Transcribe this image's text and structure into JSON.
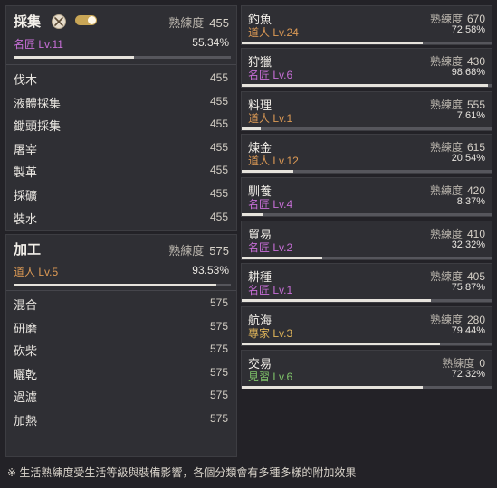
{
  "gathering": {
    "title": "採集",
    "prof_label": "熟練度",
    "prof_value": "455",
    "rank": "名匠 Lv.11",
    "rank_color": "#c86fd8",
    "percent_text": "55.34%",
    "percent": 55.34,
    "items": [
      {
        "name": "伐木",
        "value": "455"
      },
      {
        "name": "液體採集",
        "value": "455"
      },
      {
        "name": "鋤頭採集",
        "value": "455"
      },
      {
        "name": "屠宰",
        "value": "455"
      },
      {
        "name": "製革",
        "value": "455"
      },
      {
        "name": "採礦",
        "value": "455"
      },
      {
        "name": "裝水",
        "value": "455"
      }
    ]
  },
  "processing": {
    "title": "加工",
    "prof_label": "熟練度",
    "prof_value": "575",
    "rank": "道人 Lv.5",
    "rank_color": "#dd9a55",
    "percent_text": "93.53%",
    "percent": 93.53,
    "items": [
      {
        "name": "混合",
        "value": "575"
      },
      {
        "name": "研磨",
        "value": "575"
      },
      {
        "name": "砍柴",
        "value": "575"
      },
      {
        "name": "曬乾",
        "value": "575"
      },
      {
        "name": "過濾",
        "value": "575"
      },
      {
        "name": "加熱",
        "value": "575"
      }
    ]
  },
  "life_skills": [
    {
      "name": "釣魚",
      "prof_label": "熟練度",
      "prof_value": "670",
      "rank": "道人 Lv.24",
      "rank_color": "#dd9a55",
      "percent_text": "72.58%",
      "percent": 72.58
    },
    {
      "name": "狩獵",
      "prof_label": "熟練度",
      "prof_value": "430",
      "rank": "名匠 Lv.6",
      "rank_color": "#c86fd8",
      "percent_text": "98.68%",
      "percent": 98.68
    },
    {
      "name": "料理",
      "prof_label": "熟練度",
      "prof_value": "555",
      "rank": "道人 Lv.1",
      "rank_color": "#dd9a55",
      "percent_text": "7.61%",
      "percent": 7.61
    },
    {
      "name": "煉金",
      "prof_label": "熟練度",
      "prof_value": "615",
      "rank": "道人 Lv.12",
      "rank_color": "#dd9a55",
      "percent_text": "20.54%",
      "percent": 20.54
    },
    {
      "name": "馴養",
      "prof_label": "熟練度",
      "prof_value": "420",
      "rank": "名匠 Lv.4",
      "rank_color": "#c86fd8",
      "percent_text": "8.37%",
      "percent": 8.37
    },
    {
      "name": "貿易",
      "prof_label": "熟練度",
      "prof_value": "410",
      "rank": "名匠 Lv.2",
      "rank_color": "#c86fd8",
      "percent_text": "32.32%",
      "percent": 32.32
    },
    {
      "name": "耕種",
      "prof_label": "熟練度",
      "prof_value": "405",
      "rank": "名匠 Lv.1",
      "rank_color": "#c86fd8",
      "percent_text": "75.87%",
      "percent": 75.87
    },
    {
      "name": "航海",
      "prof_label": "熟練度",
      "prof_value": "280",
      "rank": "專家 Lv.3",
      "rank_color": "#e1b65a",
      "percent_text": "79.44%",
      "percent": 79.44
    },
    {
      "name": "交易",
      "prof_label": "熟練度",
      "prof_value": "0",
      "rank": "見習 Lv.6",
      "rank_color": "#7fc46a",
      "percent_text": "72.32%",
      "percent": 72.32
    }
  ],
  "footer_note": "※ 生活熟練度受生活等級與裝備影響，各個分類會有多種多樣的附加效果"
}
